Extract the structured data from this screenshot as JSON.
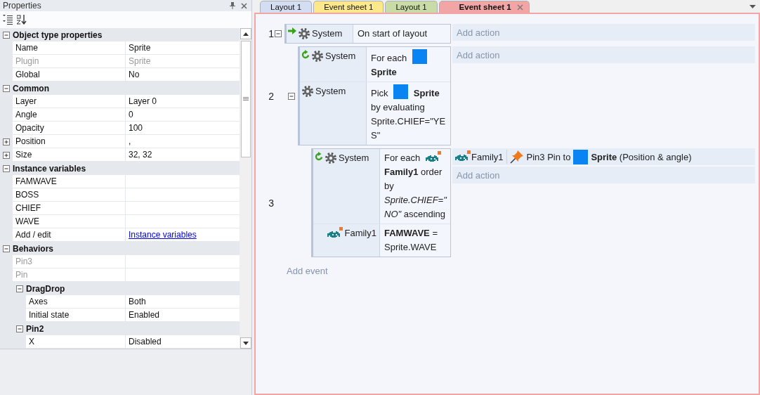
{
  "properties_panel": {
    "title": "Properties",
    "categories": [
      {
        "label": "Object type properties",
        "expanded": true,
        "rows": [
          {
            "name": "Name",
            "value": "Sprite",
            "kind": "plain",
            "disabled": false
          },
          {
            "name": "Plugin",
            "value": "Sprite",
            "kind": "plain",
            "disabled": true
          },
          {
            "name": "Global",
            "value": "No",
            "kind": "plain",
            "disabled": false
          }
        ]
      },
      {
        "label": "Common",
        "expanded": true,
        "rows": [
          {
            "name": "Layer",
            "value": "Layer 0",
            "kind": "plain",
            "disabled": false
          },
          {
            "name": "Angle",
            "value": "0",
            "kind": "plain",
            "disabled": false
          },
          {
            "name": "Opacity",
            "value": "100",
            "kind": "plain",
            "disabled": false
          },
          {
            "name": "Position",
            "value": ",",
            "kind": "group",
            "expanded": false,
            "disabled": false
          },
          {
            "name": "Size",
            "value": "32, 32",
            "kind": "group",
            "expanded": false,
            "disabled": false
          }
        ]
      },
      {
        "label": "Instance variables",
        "expanded": true,
        "rows": [
          {
            "name": "FAMWAVE",
            "kind": "plain",
            "disabled": false
          },
          {
            "name": "BOSS",
            "kind": "plain",
            "disabled": false
          },
          {
            "name": "CHIEF",
            "kind": "plain",
            "disabled": false
          },
          {
            "name": "WAVE",
            "kind": "plain",
            "disabled": false
          },
          {
            "name": "Add / edit",
            "value": "Instance variables",
            "kind": "link",
            "disabled": false
          }
        ]
      },
      {
        "label": "Behaviors",
        "expanded": true,
        "rows": [
          {
            "name": "Pin3",
            "kind": "plain",
            "disabled": true
          },
          {
            "name": "Pin",
            "kind": "plain",
            "disabled": true
          }
        ],
        "children": [
          {
            "label": "DragDrop",
            "expanded": true,
            "rows": [
              {
                "name": "Axes",
                "value": "Both",
                "kind": "plain",
                "disabled": false
              },
              {
                "name": "Initial state",
                "value": "Enabled",
                "kind": "plain",
                "disabled": false
              }
            ]
          },
          {
            "label": "Pin2",
            "expanded": true,
            "rows": [
              {
                "name": "X",
                "value": "Disabled",
                "kind": "plain",
                "disabled": false
              }
            ]
          }
        ]
      }
    ]
  },
  "tabs": [
    {
      "label": "Layout 1",
      "selected": false,
      "color": "#d3def2"
    },
    {
      "label": "Event sheet 1",
      "selected": false,
      "color": "#fde88c"
    },
    {
      "label": "Layout 1",
      "selected": false,
      "color": "#c9dca6"
    },
    {
      "label": "Event sheet 1",
      "selected": true,
      "color": "#f2a5a5"
    }
  ],
  "events": [
    {
      "number": "1",
      "expanded": true,
      "add_action": "Add action",
      "conditions": [
        {
          "kind": "trigger",
          "object": "System",
          "parts": [
            {
              "kind": "text",
              "text": "On start of layout"
            }
          ]
        }
      ],
      "children": [
        {
          "number": "2",
          "expanded": true,
          "add_action": "Add action",
          "conditions": [
            {
              "kind": "loop",
              "object": "System",
              "parts": [
                {
                  "kind": "text",
                  "text": "For each"
                },
                {
                  "kind": "sprite"
                },
                {
                  "kind": "line",
                  "text": "**Sprite**"
                }
              ]
            },
            {
              "kind": "system",
              "object": "System",
              "parts": [
                {
                  "kind": "text",
                  "text": "Pick"
                },
                {
                  "kind": "sprite"
                },
                {
                  "kind": "text",
                  "text": "**Sprite**"
                },
                {
                  "kind": "line",
                  "text": "by evaluating Sprite.CHIEF=\"YES\""
                }
              ]
            }
          ],
          "children": [
            {
              "number": "3",
              "add_action": "Add action",
              "conditions": [
                {
                  "kind": "loop",
                  "object": "System",
                  "parts": [
                    {
                      "kind": "text",
                      "text": "For each"
                    },
                    {
                      "kind": "family"
                    },
                    {
                      "kind": "line",
                      "text": "**Family1** order by *Sprite.CHIEF=\"NO\"* ascending"
                    }
                  ]
                },
                {
                  "kind": "family",
                  "object": "Family1",
                  "parts": [
                    {
                      "kind": "line",
                      "text": "**FAMWAVE** = Sprite.WAVE"
                    }
                  ]
                }
              ],
              "actions": [
                {
                  "kind": "family",
                  "object": "Family1",
                  "parts": [
                    {
                      "kind": "pin"
                    },
                    {
                      "kind": "text",
                      "text": "Pin3 Pin to"
                    },
                    {
                      "kind": "sprite"
                    },
                    {
                      "kind": "text",
                      "text": "**Sprite** (Position & angle)"
                    }
                  ]
                }
              ]
            }
          ]
        }
      ]
    }
  ],
  "add_event": "Add event"
}
